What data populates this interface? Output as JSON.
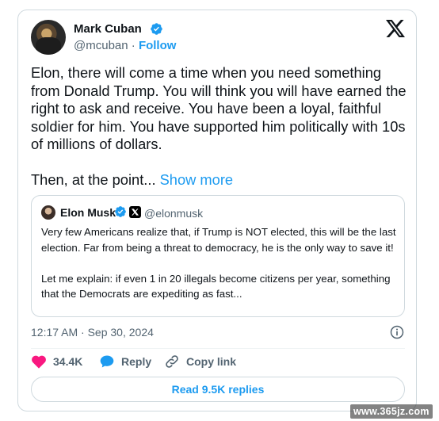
{
  "author": {
    "name": "Mark Cuban",
    "handle": "@mcuban",
    "separator": "·",
    "follow_label": "Follow"
  },
  "tweet": {
    "paragraphs": [
      "Elon, there will come a time when you need something from Donald Trump.  You will think you will have earned the right to ask and receive.  You have been a loyal, faithful soldier for him. You have supported him politically with 10s of millions of dollars.",
      "Then, at the point..."
    ],
    "show_more_label": " Show more"
  },
  "quote": {
    "name": "Elon Musk",
    "handle": "@elonmusk",
    "paragraphs": [
      "Very few Americans realize that, if Trump is NOT elected, this will be the last election. Far from being a threat to democracy, he is the only way to save it!",
      "Let me explain: if even 1 in 20 illegals become citizens per year, something that the Democrats are expediting as fast..."
    ]
  },
  "timestamp": "12:17 AM · Sep 30, 2024",
  "actions": {
    "likes": "34.4K",
    "reply_label": "Reply",
    "copy_link_label": "Copy link"
  },
  "replies_button_label": "Read 9.5K replies",
  "watermark": "www.365jz.com",
  "icons": {
    "verified": "verified-badge-icon",
    "x_logo": "x-logo-icon",
    "like": "heart-icon",
    "reply": "speech-bubble-icon",
    "copy": "link-icon",
    "info": "info-icon"
  },
  "colors": {
    "accent": "#1d9bf0",
    "like": "#f91880",
    "muted": "#536471",
    "border": "#cfd9de"
  }
}
